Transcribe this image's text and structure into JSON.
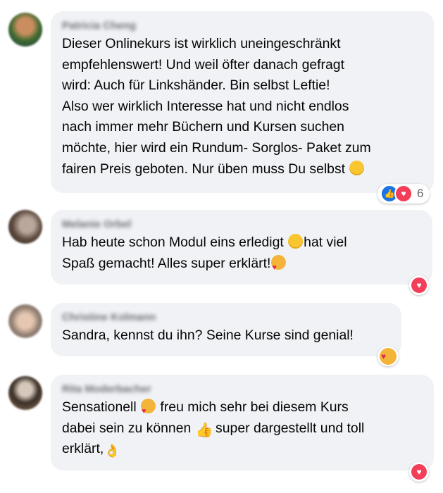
{
  "comments": [
    {
      "author": "Patricia Cheng",
      "text": "Dieser Onlinekurs ist wirklich uneingeschränkt\nempfehlenswert! Und weil öfter danach gefragt\nwird: Auch für Linkshänder. Bin selbst Leftie!\nAlso wer wirklich Interesse hat und nicht endlos\nnach immer mehr Büchern und Kursen suchen\nmöchte, hier wird ein Rundum- Sorglos- Paket zum\nfairen Preis geboten. Nur üben muss Du selbst",
      "reaction_count": "6"
    },
    {
      "author": "Melanie Orbel",
      "text_line1_a": "Hab heute schon Modul eins erledigt ",
      "text_line1_b": "hat viel",
      "text_line2": "Spaß gemacht! Alles super erklärt!"
    },
    {
      "author": "Christine Kolmann",
      "text": "Sandra, kennst du ihn? Seine Kurse sind genial!"
    },
    {
      "author": "Rita Moderbacher",
      "text_line1_a": "Sensationell ",
      "text_line1_b": " freu mich sehr bei diesem Kurs",
      "text_line2_a": "dabei sein zu können ",
      "text_line2_b": " super dargestellt und toll",
      "text_line3": "erklärt,"
    }
  ],
  "colors": {
    "bubble": "#f0f2f5",
    "like_blue": "#1b74e4",
    "love_red": "#f33e58",
    "emoji_yellow": "#f9c630"
  },
  "icons": [
    "avatar",
    "grinning-emoji",
    "smiling-face-with-hearts-emoji",
    "thumbs-up-emoji",
    "ok-hand-emoji",
    "like-reaction-icon",
    "love-reaction-icon",
    "care-reaction-icon"
  ]
}
